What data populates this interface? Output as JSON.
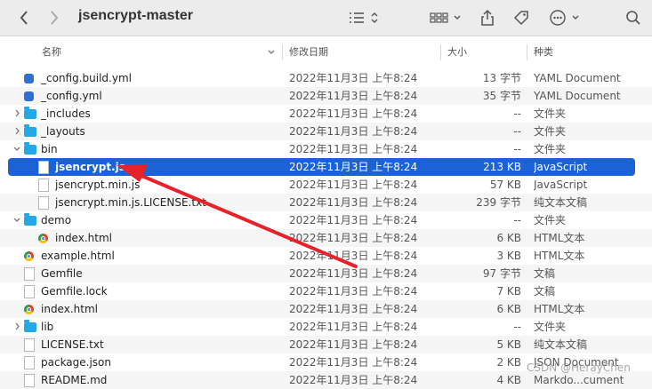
{
  "window": {
    "title": "jsencrypt-master"
  },
  "toolbar": {
    "back_icon": "chevron-left-icon",
    "forward_icon": "chevron-right-icon",
    "list_view_icon": "list-view-icon",
    "group_icon": "icon-grid-icon",
    "share_icon": "share-icon",
    "tag_icon": "tag-icon",
    "more_icon": "ellipsis-circle-icon",
    "search_icon": "search-icon"
  },
  "columns": {
    "name": "名称",
    "date": "修改日期",
    "size": "大小",
    "kind": "种类"
  },
  "files": [
    {
      "name": "_config.build.yml",
      "date": "2022年11月3日 上午8:24",
      "size": "13 字节",
      "kind": "YAML Document",
      "icon": "yml",
      "indent": 0,
      "disclosure": ""
    },
    {
      "name": "_config.yml",
      "date": "2022年11月3日 上午8:24",
      "size": "35 字节",
      "kind": "YAML Document",
      "icon": "yml",
      "indent": 0,
      "disclosure": ""
    },
    {
      "name": "_includes",
      "date": "2022年11月3日 上午8:24",
      "size": "--",
      "kind": "文件夹",
      "icon": "folder",
      "indent": 0,
      "disclosure": "collapsed"
    },
    {
      "name": "_layouts",
      "date": "2022年11月3日 上午8:24",
      "size": "--",
      "kind": "文件夹",
      "icon": "folder",
      "indent": 0,
      "disclosure": "collapsed"
    },
    {
      "name": "bin",
      "date": "2022年11月3日 上午8:24",
      "size": "--",
      "kind": "文件夹",
      "icon": "folder",
      "indent": 0,
      "disclosure": "expanded"
    },
    {
      "name": "jsencrypt.js",
      "date": "2022年11月3日 上午8:24",
      "size": "213 KB",
      "kind": "JavaScript",
      "icon": "doc",
      "indent": 1,
      "disclosure": "",
      "selected": true
    },
    {
      "name": "jsencrypt.min.js",
      "date": "2022年11月3日 上午8:24",
      "size": "57 KB",
      "kind": "JavaScript",
      "icon": "doc",
      "indent": 1,
      "disclosure": ""
    },
    {
      "name": "jsencrypt.min.js.LICENSE.txt",
      "date": "2022年11月3日 上午8:24",
      "size": "239 字节",
      "kind": "纯文本文稿",
      "icon": "doc",
      "indent": 1,
      "disclosure": ""
    },
    {
      "name": "demo",
      "date": "2022年11月3日 上午8:24",
      "size": "--",
      "kind": "文件夹",
      "icon": "folder",
      "indent": 0,
      "disclosure": "expanded"
    },
    {
      "name": "index.html",
      "date": "2022年11月3日 上午8:24",
      "size": "6 KB",
      "kind": "HTML文本",
      "icon": "chrome",
      "indent": 1,
      "disclosure": ""
    },
    {
      "name": "example.html",
      "date": "2022年11月3日 上午8:24",
      "size": "3 KB",
      "kind": "HTML文本",
      "icon": "chrome",
      "indent": 0,
      "disclosure": ""
    },
    {
      "name": "Gemfile",
      "date": "2022年11月3日 上午8:24",
      "size": "97 字节",
      "kind": "文稿",
      "icon": "doc",
      "indent": 0,
      "disclosure": ""
    },
    {
      "name": "Gemfile.lock",
      "date": "2022年11月3日 上午8:24",
      "size": "7 KB",
      "kind": "文稿",
      "icon": "doc",
      "indent": 0,
      "disclosure": ""
    },
    {
      "name": "index.html",
      "date": "2022年11月3日 上午8:24",
      "size": "6 KB",
      "kind": "HTML文本",
      "icon": "chrome",
      "indent": 0,
      "disclosure": ""
    },
    {
      "name": "lib",
      "date": "2022年11月3日 上午8:24",
      "size": "--",
      "kind": "文件夹",
      "icon": "folder",
      "indent": 0,
      "disclosure": "collapsed"
    },
    {
      "name": "LICENSE.txt",
      "date": "2022年11月3日 上午8:24",
      "size": "5 KB",
      "kind": "纯文本文稿",
      "icon": "doc",
      "indent": 0,
      "disclosure": ""
    },
    {
      "name": "package.json",
      "date": "2022年11月3日 上午8:24",
      "size": "2 KB",
      "kind": "JSON Document",
      "icon": "doc",
      "indent": 0,
      "disclosure": ""
    },
    {
      "name": "README.md",
      "date": "2022年11月3日 上午8:24",
      "size": "4 KB",
      "kind": "Markdo...cument",
      "icon": "doc",
      "indent": 0,
      "disclosure": ""
    }
  ],
  "annotation": {
    "color": "#e8222a"
  },
  "watermark": "CSDN @HerayChen",
  "colors": {
    "selection": "#1a62d6",
    "folder": "#27a8e6"
  }
}
